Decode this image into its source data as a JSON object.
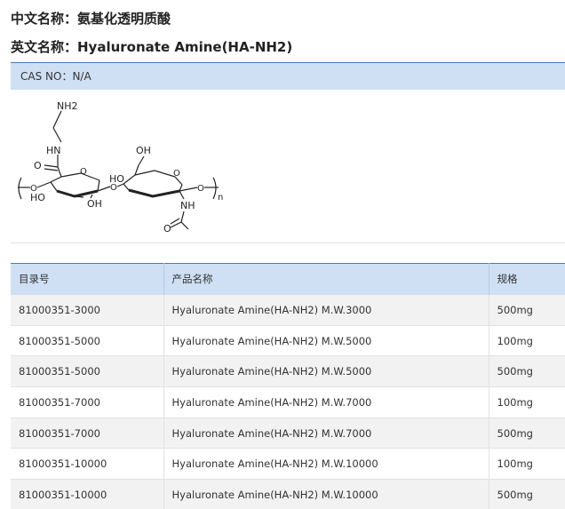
{
  "header": {
    "cn_name_label": "中文名称：氨基化透明质酸",
    "en_name_label": "英文名称：Hyaluronate Amine(HA-NH2)"
  },
  "cas": {
    "text": "CAS NO：N/A"
  },
  "structure": {
    "labels": {
      "nh2": "NH2",
      "hn": "HN",
      "o_carbonyl": "O",
      "oh_top": "OH",
      "ho_left": "HO",
      "ho_mid": "HO",
      "oh_bottom": "OH",
      "nh": "NH",
      "o_acetyl": "O",
      "n_sub": "n"
    }
  },
  "table": {
    "headers": [
      "目录号",
      "产品名称",
      "规格"
    ],
    "rows": [
      [
        "81000351-3000",
        "Hyaluronate Amine(HA-NH2) M.W.3000",
        "500mg"
      ],
      [
        "81000351-5000",
        "Hyaluronate Amine(HA-NH2) M.W.5000",
        "100mg"
      ],
      [
        "81000351-5000",
        "Hyaluronate Amine(HA-NH2) M.W.5000",
        "500mg"
      ],
      [
        "81000351-7000",
        "Hyaluronate Amine(HA-NH2) M.W.7000",
        "100mg"
      ],
      [
        "81000351-7000",
        "Hyaluronate Amine(HA-NH2) M.W.7000",
        "500mg"
      ],
      [
        "81000351-10000",
        "Hyaluronate Amine(HA-NH2) M.W.10000",
        "100mg"
      ],
      [
        "81000351-10000",
        "Hyaluronate Amine(HA-NH2) M.W.10000",
        "500mg"
      ]
    ]
  }
}
